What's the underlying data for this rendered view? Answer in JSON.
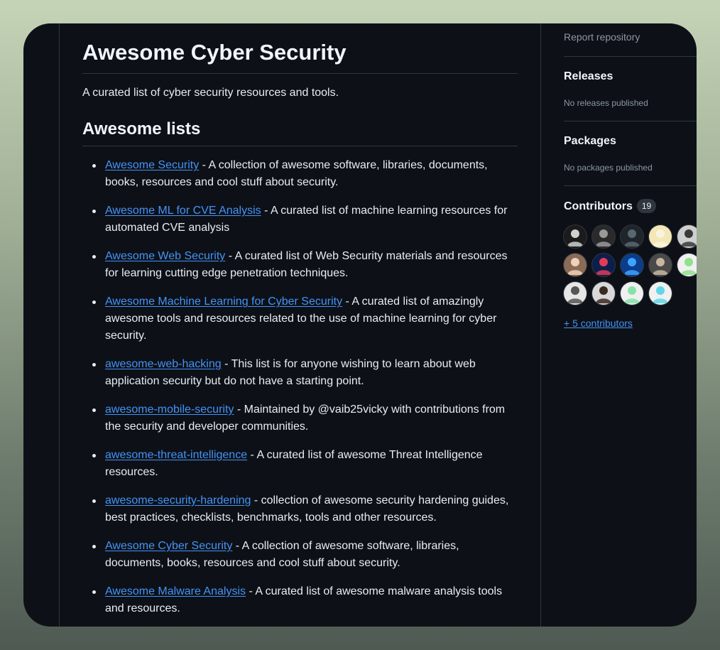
{
  "readme": {
    "title": "Awesome Cyber Security",
    "description": "A curated list of cyber security resources and tools.",
    "section_heading": "Awesome lists",
    "items": [
      {
        "link": "Awesome Security",
        "text": " - A collection of awesome software, libraries, documents, books, resources and cool stuff about security."
      },
      {
        "link": "Awesome ML for CVE Analysis",
        "text": " - A curated list of machine learning resources for automated CVE analysis"
      },
      {
        "link": "Awesome Web Security",
        "text": " - A curated list of Web Security materials and resources for learning cutting edge penetration techniques."
      },
      {
        "link": "Awesome Machine Learning for Cyber Security",
        "text": " - A curated list of amazingly awesome tools and resources related to the use of machine learning for cyber security."
      },
      {
        "link": "awesome-web-hacking",
        "text": " - This list is for anyone wishing to learn about web application security but do not have a starting point."
      },
      {
        "link": "awesome-mobile-security",
        "text": " - Maintained by @vaib25vicky with contributions from the security and developer communities."
      },
      {
        "link": "awesome-threat-intelligence",
        "text": " - A curated list of awesome Threat Intelligence resources."
      },
      {
        "link": "awesome-security-hardening",
        "text": " - collection of awesome security hardening guides, best practices, checklists, benchmarks, tools and other resources."
      },
      {
        "link": "Awesome Cyber Security",
        "text": " - A collection of awesome software, libraries, documents, books, resources and cool stuff about security."
      },
      {
        "link": "Awesome Malware Analysis",
        "text": " - A curated list of awesome malware analysis tools and resources."
      }
    ]
  },
  "sidebar": {
    "report_label": "Report repository",
    "releases": {
      "heading": "Releases",
      "empty": "No releases published"
    },
    "packages": {
      "heading": "Packages",
      "empty": "No packages published"
    },
    "contributors": {
      "heading": "Contributors",
      "count": "19",
      "more_label": "+ 5 contributors",
      "avatars": [
        {
          "icon": "avatar-dark-logo-icon",
          "bg": "#1b1b1b",
          "fg": "#d0d0d0"
        },
        {
          "icon": "avatar-dark-art-icon",
          "bg": "#2a2a2a",
          "fg": "#9a9a9a"
        },
        {
          "icon": "avatar-dark-person-icon",
          "bg": "#1e252b",
          "fg": "#5a6670"
        },
        {
          "icon": "avatar-light-yellow-icon",
          "bg": "#f3e7b8",
          "fg": "#f8f3df"
        },
        {
          "icon": "avatar-grey-person-icon",
          "bg": "#cfcfcf",
          "fg": "#3a3a3a"
        },
        {
          "icon": "avatar-photo-person-icon",
          "bg": "#8a6b58",
          "fg": "#f0d2b8"
        },
        {
          "icon": "avatar-blue-cyber-icon",
          "bg": "#0c1f4a",
          "fg": "#e23b5a"
        },
        {
          "icon": "avatar-blue-shield-icon",
          "bg": "#0b3d8a",
          "fg": "#3fa2ff"
        },
        {
          "icon": "avatar-photo-group-icon",
          "bg": "#4a4a4a",
          "fg": "#c8b6a0"
        },
        {
          "icon": "avatar-green-pattern-icon",
          "bg": "#f0f0f0",
          "fg": "#8fe28a"
        },
        {
          "icon": "avatar-sketch-person-icon",
          "bg": "#e6e6e6",
          "fg": "#555555"
        },
        {
          "icon": "avatar-photo-man-icon",
          "bg": "#d8d8d8",
          "fg": "#3b2a22"
        },
        {
          "icon": "avatar-green-cross-icon",
          "bg": "#f0f0f0",
          "fg": "#86e3a8"
        },
        {
          "icon": "avatar-cyan-cross-icon",
          "bg": "#f0f0f0",
          "fg": "#5fd7e8"
        }
      ]
    }
  },
  "colors": {
    "link": "#4493f8",
    "background": "#0d1117",
    "border": "#30363d"
  }
}
